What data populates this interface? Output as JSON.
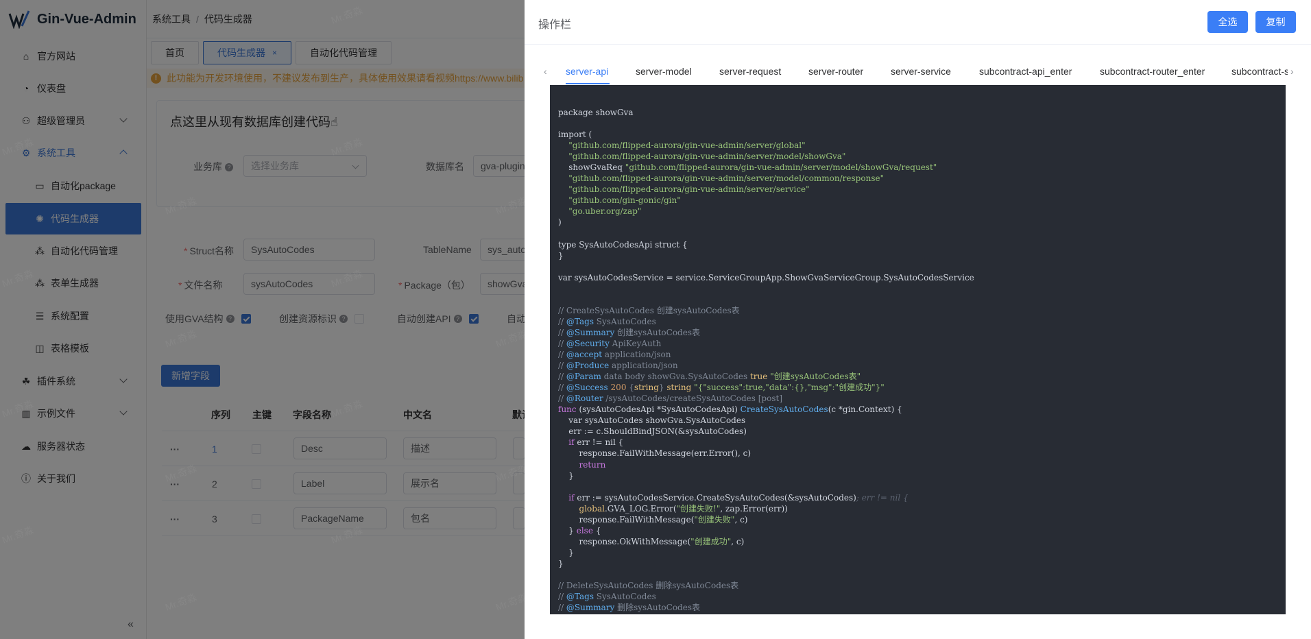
{
  "app": {
    "title": "Gin-Vue-Admin"
  },
  "breadcrumb": [
    "系统工具",
    "代码生成器"
  ],
  "sidebar": {
    "items": [
      {
        "label": "官方网站",
        "icon": "home-icon"
      },
      {
        "label": "仪表盘",
        "icon": "dashboard-icon"
      },
      {
        "label": "超级管理员",
        "icon": "user-icon"
      },
      {
        "label": "系统工具",
        "icon": "gear-icon"
      },
      {
        "label": "自动化package",
        "icon": "folder-icon"
      },
      {
        "label": "代码生成器",
        "icon": "cpu-icon"
      },
      {
        "label": "自动化代码管理",
        "icon": "magic-icon"
      },
      {
        "label": "表单生成器",
        "icon": "magic-icon"
      },
      {
        "label": "系统配置",
        "icon": "sliders-icon"
      },
      {
        "label": "表格模板",
        "icon": "book-icon"
      },
      {
        "label": "插件系统",
        "icon": "plugin-icon"
      },
      {
        "label": "示例文件",
        "icon": "files-icon"
      },
      {
        "label": "服务器状态",
        "icon": "cloud-icon"
      },
      {
        "label": "关于我们",
        "icon": "info-icon"
      }
    ]
  },
  "tabs": [
    {
      "label": "首页"
    },
    {
      "label": "代码生成器",
      "close": "×"
    },
    {
      "label": "自动化代码管理"
    }
  ],
  "warning": {
    "text": "此功能为开发环境使用，不建议发布到生产，具体使用效果请看视频https://www.bilib"
  },
  "db_card": {
    "title": "点这里从现有数据库创建代码☝",
    "business_db_label": "业务库",
    "business_db_placeholder": "选择业务库",
    "db_name_label": "数据库名",
    "db_name_value": "gva-plugin"
  },
  "form": {
    "struct_label": "Struct名称",
    "struct_value": "SysAutoCodes",
    "table_label": "TableName",
    "table_value": "sys_auto",
    "file_label": "文件名称",
    "file_value": "sysAutoCodes",
    "package_label": "Package（包）",
    "package_value": "showGva",
    "gva_struct_label": "使用GVA结构",
    "resource_label": "创建资源标识",
    "auto_api_label": "自动创建API",
    "auto_more_label": "自动"
  },
  "fields_table": {
    "add_button": "新增字段",
    "headers": [
      "序列",
      "主键",
      "字段名称",
      "中文名",
      "默认"
    ],
    "rows": [
      {
        "index": "1",
        "name": "Desc",
        "cn": "描述"
      },
      {
        "index": "2",
        "name": "Label",
        "cn": "展示名"
      },
      {
        "index": "3",
        "name": "PackageName",
        "cn": "包名"
      }
    ],
    "row_menu": "···"
  },
  "watermark": "Mr.奇淼",
  "drawer": {
    "title": "操作栏",
    "select_all": "全选",
    "copy": "复制",
    "code_tabs": [
      "server-api",
      "server-model",
      "server-request",
      "server-router",
      "server-service",
      "subcontract-api_enter",
      "subcontract-router_enter",
      "subcontract-ser"
    ],
    "active_tab": "server-api"
  },
  "colors": {
    "primary": "#3a7ef6",
    "sidebar_active": "#3a76d6",
    "code_bg": "#282c34",
    "warning": "#e6a23c"
  }
}
